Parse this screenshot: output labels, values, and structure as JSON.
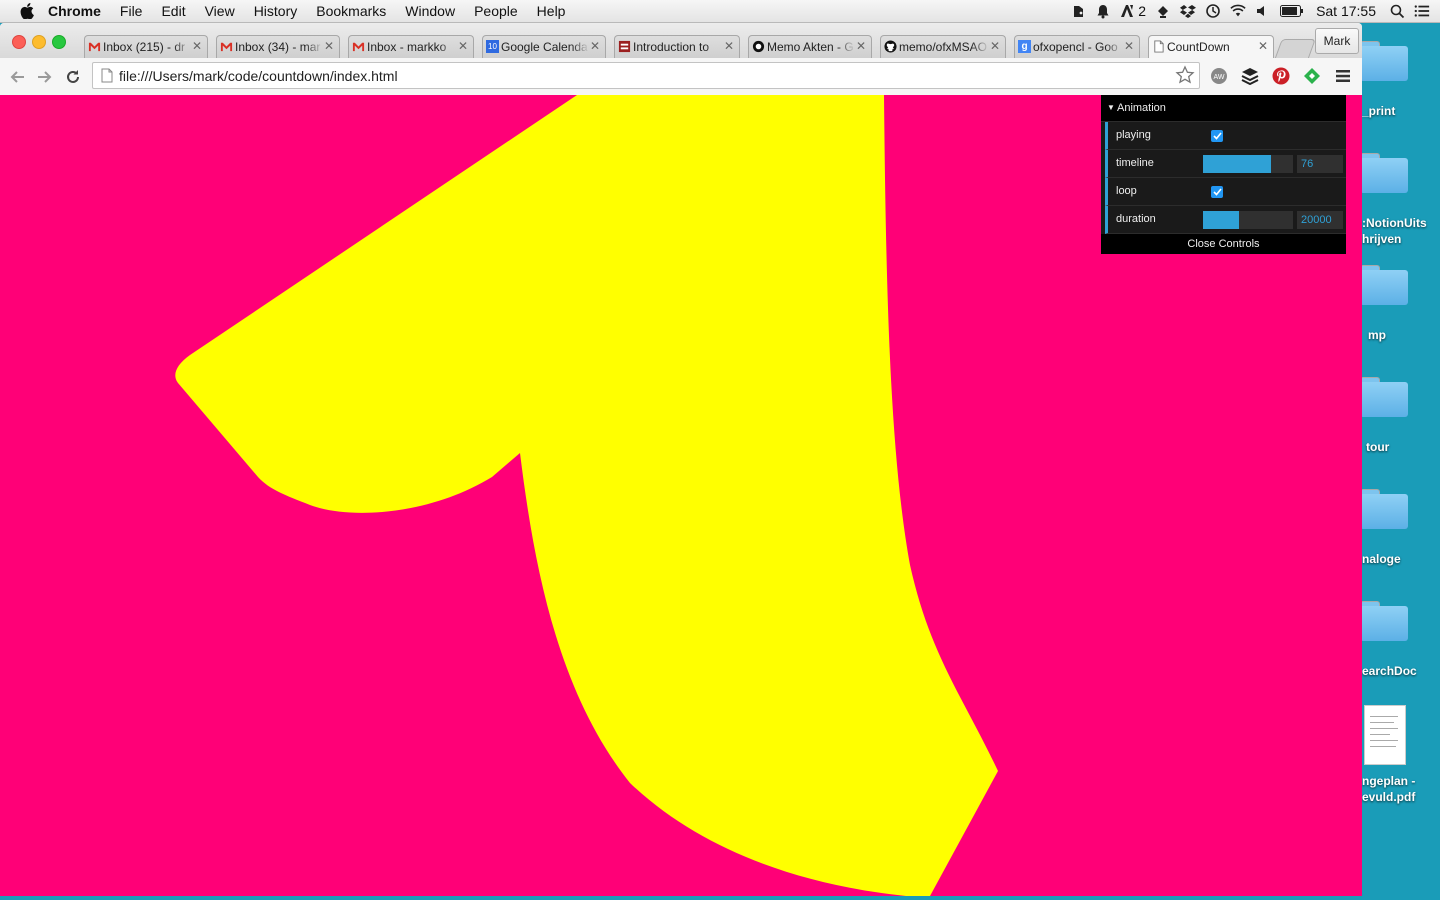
{
  "menubar": {
    "app_name": "Chrome",
    "items": [
      "File",
      "Edit",
      "View",
      "History",
      "Bookmarks",
      "Window",
      "People",
      "Help"
    ],
    "status_a_count": "2",
    "clock": "Sat 17:55"
  },
  "browser": {
    "tabs": [
      {
        "title": "Inbox (215) - dr",
        "icon": "gmail-icon"
      },
      {
        "title": "Inbox (34) - mar",
        "icon": "gmail-icon"
      },
      {
        "title": "Inbox - markko",
        "icon": "gmail-icon"
      },
      {
        "title": "Google Calenda",
        "icon": "calendar-icon",
        "icon_text": "10"
      },
      {
        "title": "Introduction to",
        "icon": "site-icon"
      },
      {
        "title": "Memo Akten - G",
        "icon": "site-icon"
      },
      {
        "title": "memo/ofxMSAO",
        "icon": "github-icon"
      },
      {
        "title": "ofxopencl - Goo",
        "icon": "google-icon"
      },
      {
        "title": "CountDown",
        "icon": "page-icon",
        "active": true
      }
    ],
    "profile_name": "Mark",
    "url": "file:///Users/mark/code/countdown/index.html"
  },
  "page": {
    "background_color": "#ff0077",
    "shape_color": "#ffff00",
    "gui": {
      "folder_title": "Animation",
      "controls": [
        {
          "label": "playing",
          "type": "checkbox",
          "checked": true
        },
        {
          "label": "timeline",
          "type": "slider",
          "value": "76",
          "fill_fraction": 0.76
        },
        {
          "label": "loop",
          "type": "checkbox",
          "checked": true
        },
        {
          "label": "duration",
          "type": "slider",
          "value": "20000",
          "fill_fraction": 0.4
        }
      ],
      "close_label": "Close Controls"
    }
  },
  "desktop": {
    "items": [
      {
        "label_lines": [
          "_print"
        ],
        "type": "folder"
      },
      {
        "label_lines": [
          ":NotionUits",
          "hrijven"
        ],
        "type": "folder"
      },
      {
        "label_lines": [
          "mp"
        ],
        "type": "folder"
      },
      {
        "label_lines": [
          "tour"
        ],
        "type": "folder"
      },
      {
        "label_lines": [
          "naloge"
        ],
        "type": "folder"
      },
      {
        "label_lines": [
          "earchDoc"
        ],
        "type": "folder"
      },
      {
        "label_lines": [
          "ngeplan -",
          "evuld.pdf"
        ],
        "type": "pdf"
      }
    ]
  }
}
